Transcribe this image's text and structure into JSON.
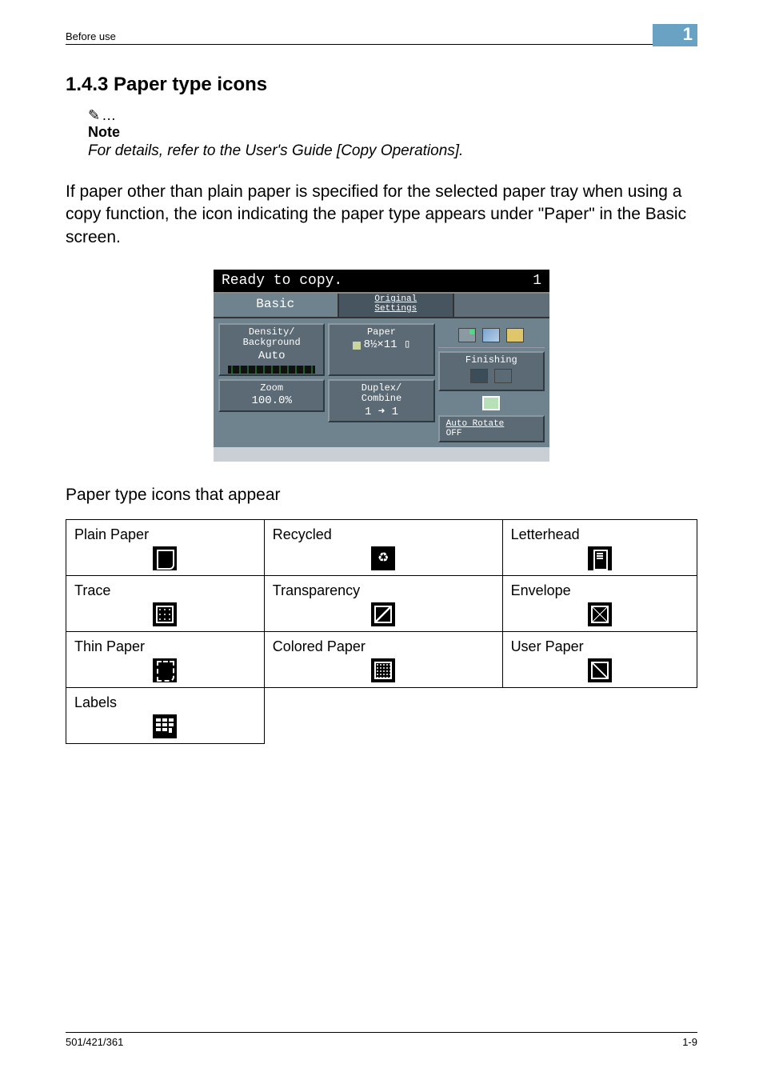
{
  "header": {
    "section": "Before use",
    "chapter": "1"
  },
  "heading": "1.4.3   Paper type icons",
  "note": {
    "icon": "✎",
    "ellipsis": "…",
    "label": "Note",
    "text": "For details, refer to the User's Guide [Copy Operations]."
  },
  "body": "If paper other than plain paper is specified for the selected paper tray when using a copy function, the icon indicating the paper type appears under \"Paper\" in the Basic screen.",
  "copier": {
    "status": "Ready to copy.",
    "count": "1",
    "tabs": {
      "basic": "Basic",
      "original_line1": "Original",
      "original_line2": "Settings"
    },
    "buttons": {
      "density_label": "Density/",
      "background_label": "Background",
      "density_value": "Auto",
      "zoom_label": "Zoom",
      "zoom_value": "100.0%",
      "paper_label": "Paper",
      "paper_value": "8½×11 ▯",
      "duplex_label": "Duplex/",
      "combine_label": "Combine",
      "duplex_value": "1 ➜ 1",
      "finishing_label": "Finishing",
      "auto_rotate_line1": "Auto Rotate",
      "auto_rotate_line2": "OFF"
    }
  },
  "caption": "Paper type icons that appear",
  "icons": {
    "plain": "Plain Paper",
    "recycled": "Recycled",
    "letterhead": "Letterhead",
    "trace": "Trace",
    "transparency": "Transparency",
    "envelope": "Envelope",
    "thin": "Thin Paper",
    "colored": "Colored Paper",
    "user": "User Paper",
    "labels": "Labels"
  },
  "footer": {
    "left": "501/421/361",
    "right": "1-9"
  }
}
